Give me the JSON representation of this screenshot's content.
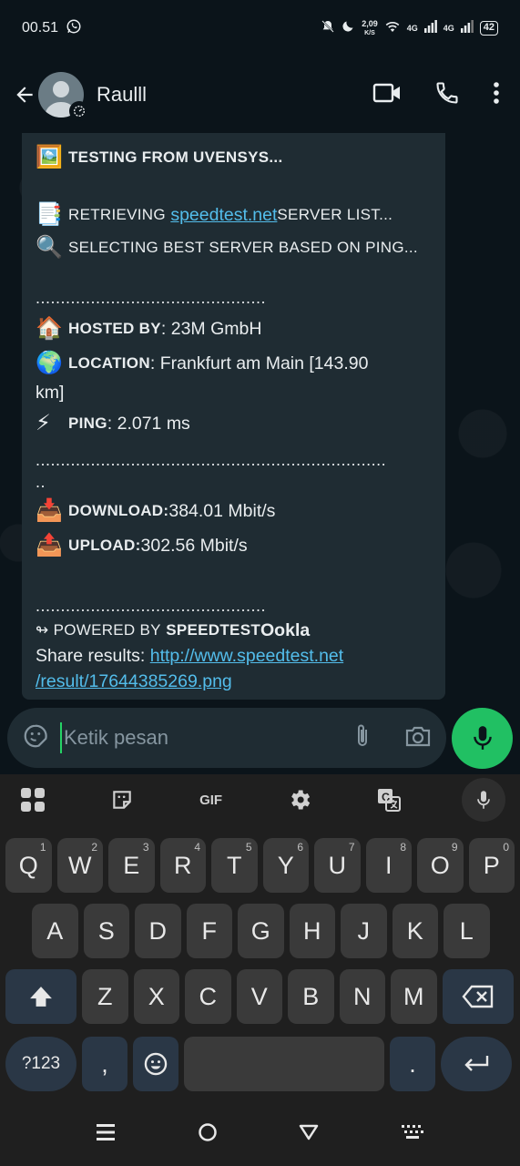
{
  "status_bar": {
    "time": "00.51",
    "net_speed_top": "2,09",
    "net_speed_unit": "K/S",
    "network_1": "4G",
    "network_2": "4G",
    "battery": "42"
  },
  "header": {
    "contact_name": "Raulll"
  },
  "message": {
    "line1": "TESTING FROM UVENSYS...",
    "line2_prefix": "RETRIEVING ",
    "line2_link": "speedtest.net",
    "line2_suffix": " SERVER LIST...",
    "line3": "SELECTING BEST SERVER BASED ON PING...",
    "separator1": "..............................................",
    "hosted_label": "HOSTED BY",
    "hosted_value": " : 23M GmbH",
    "location_label": "LOCATION",
    "location_value": " : Frankfurt am Main [143.90",
    "location_value_cont": "km]",
    "ping_label": "PING",
    "ping_value": " : 2.071 ms",
    "separator2": "......................................................................",
    "separator2_cont": "..",
    "download_label": "DOWNLOAD:",
    "download_value": " 384.01 Mbit/s",
    "upload_label": "UPLOAD:",
    "upload_value": " 302.56 Mbit/s",
    "separator3": "..............................................",
    "powered_prefix": "↬ POWERED BY ",
    "powered_brand": "SPEEDTEST",
    "powered_ookla": " Ookla",
    "share_label": "Share results: ",
    "share_link_1": "http://www.speedtest.net",
    "share_link_2": "/result/17644385269.png"
  },
  "composer": {
    "placeholder": "Ketik pesan"
  },
  "keyboard": {
    "toolbar_gif": "GIF",
    "row1": [
      {
        "k": "Q",
        "h": "1"
      },
      {
        "k": "W",
        "h": "2"
      },
      {
        "k": "E",
        "h": "3"
      },
      {
        "k": "R",
        "h": "4"
      },
      {
        "k": "T",
        "h": "5"
      },
      {
        "k": "Y",
        "h": "6"
      },
      {
        "k": "U",
        "h": "7"
      },
      {
        "k": "I",
        "h": "8"
      },
      {
        "k": "O",
        "h": "9"
      },
      {
        "k": "P",
        "h": "0"
      }
    ],
    "row2": [
      "A",
      "S",
      "D",
      "F",
      "G",
      "H",
      "J",
      "K",
      "L"
    ],
    "row3": [
      "Z",
      "X",
      "C",
      "V",
      "B",
      "N",
      "M"
    ],
    "symbols_key": "?123",
    "comma_key": ",",
    "period_key": "."
  }
}
